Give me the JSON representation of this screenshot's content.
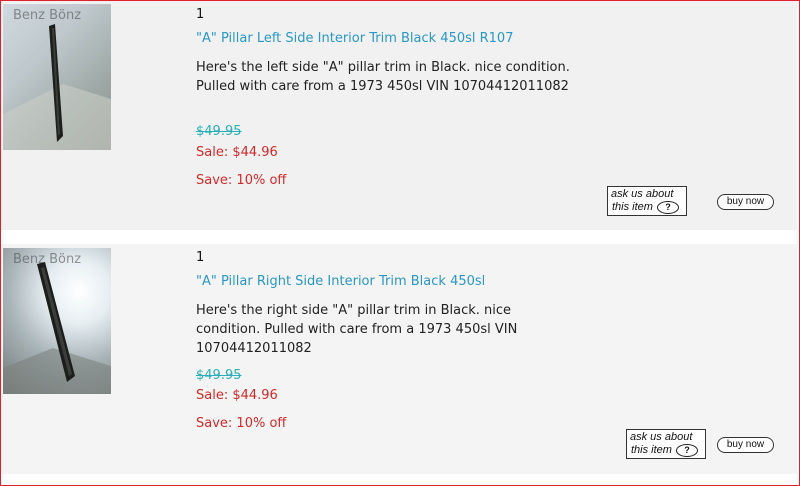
{
  "items": [
    {
      "watermark": "Benz Bönz",
      "qty": "1",
      "title": "\"A\" Pillar Left Side Interior Trim Black 450sl R107",
      "description": "Here's the left side \"A\" pillar trim in Black. nice condition. Pulled with care from a 1973 450sl VIN 10704412011082",
      "original_price": "$49.95",
      "sale": "Sale: $44.96",
      "save": "Save: 10% off",
      "ask_line1": "ask us about",
      "ask_line2": "this item",
      "buy_label": "buy now"
    },
    {
      "watermark": "Benz Bönz",
      "qty": "1",
      "title": "\"A\" Pillar Right Side Interior Trim Black 450sl",
      "description": "Here's the right side \"A\" pillar trim in Black. nice condition. Pulled with care from a 1973 450sl VIN 10704412011082",
      "original_price": "$49.95",
      "sale": "Sale: $44.96",
      "save": "Save: 10% off",
      "ask_line1": "ask us about",
      "ask_line2": "this item",
      "buy_label": "buy now"
    }
  ],
  "colors": {
    "title": "#2a97c9",
    "sale": "#d22a2a",
    "original": "#2ab0b8",
    "frame_border": "#e0202a"
  },
  "icons": {
    "help": "question-mark-icon"
  }
}
